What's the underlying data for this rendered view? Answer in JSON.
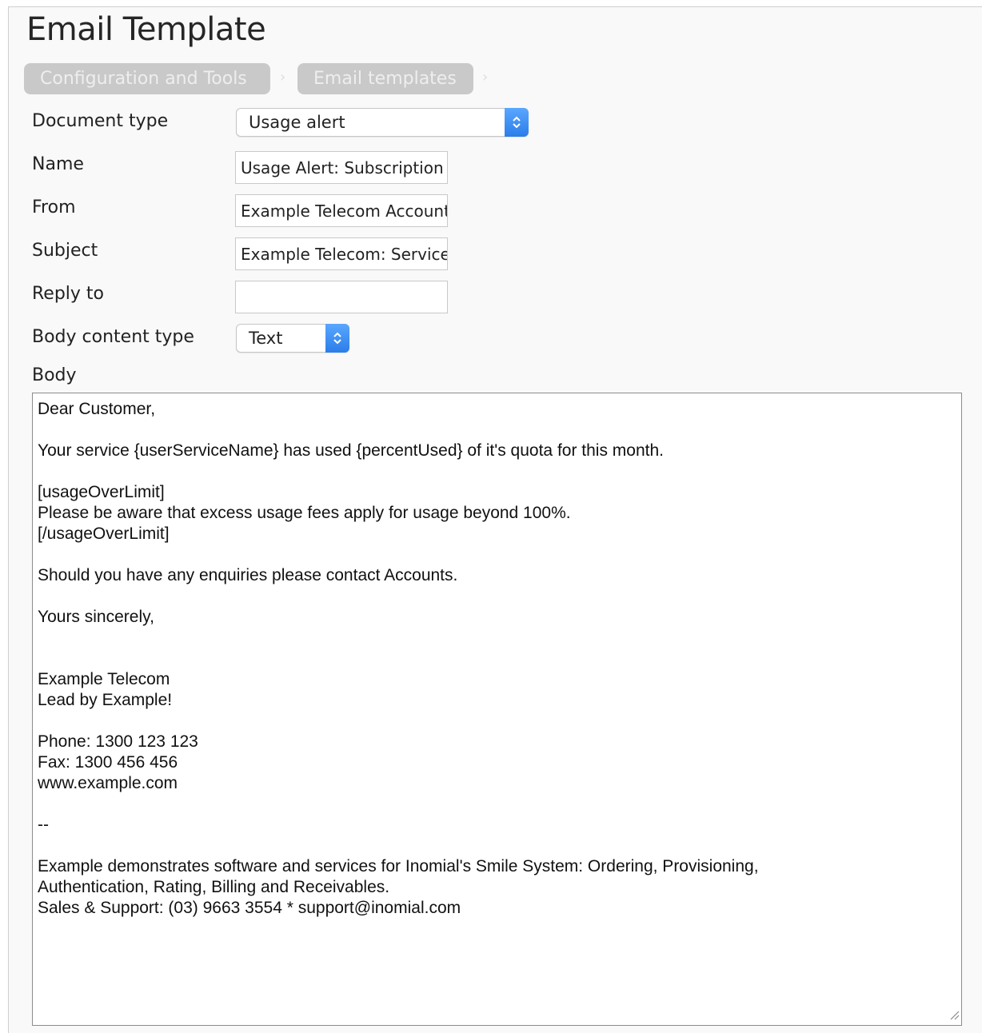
{
  "page": {
    "title": "Email Template"
  },
  "breadcrumbs": [
    {
      "label": "Configuration and Tools"
    },
    {
      "label": "Email templates"
    }
  ],
  "form": {
    "document_type": {
      "label": "Document type",
      "value": "Usage alert"
    },
    "name": {
      "label": "Name",
      "value": "Usage Alert: Subscription"
    },
    "from": {
      "label": "From",
      "value": "Example Telecom Accounts"
    },
    "subject": {
      "label": "Subject",
      "value": "Example Telecom: Service"
    },
    "reply_to": {
      "label": "Reply to",
      "value": ""
    },
    "body_content_type": {
      "label": "Body content type",
      "value": "Text"
    },
    "body": {
      "label": "Body",
      "value": "Dear Customer,\n\nYour service {userServiceName} has used {percentUsed} of it's quota for this month.\n\n[usageOverLimit]\nPlease be aware that excess usage fees apply for usage beyond 100%.\n[/usageOverLimit]\n\nShould you have any enquiries please contact Accounts.\n\nYours sincerely,\n\n\nExample Telecom\nLead by Example!\n\nPhone: 1300 123 123\nFax: 1300 456 456\nwww.example.com\n\n--\n\nExample demonstrates software and services for Inomial's Smile System: Ordering, Provisioning,\nAuthentication, Rating, Billing and Receivables.\nSales & Support: (03) 9663 3554 * support@inomial.com"
    }
  },
  "icons": {
    "select_arrow": "updown-chevron-icon",
    "resize": "resize-grip-icon"
  },
  "colors": {
    "accent": "#2b7de9",
    "breadcrumb_bg": "#c9c9c9"
  }
}
